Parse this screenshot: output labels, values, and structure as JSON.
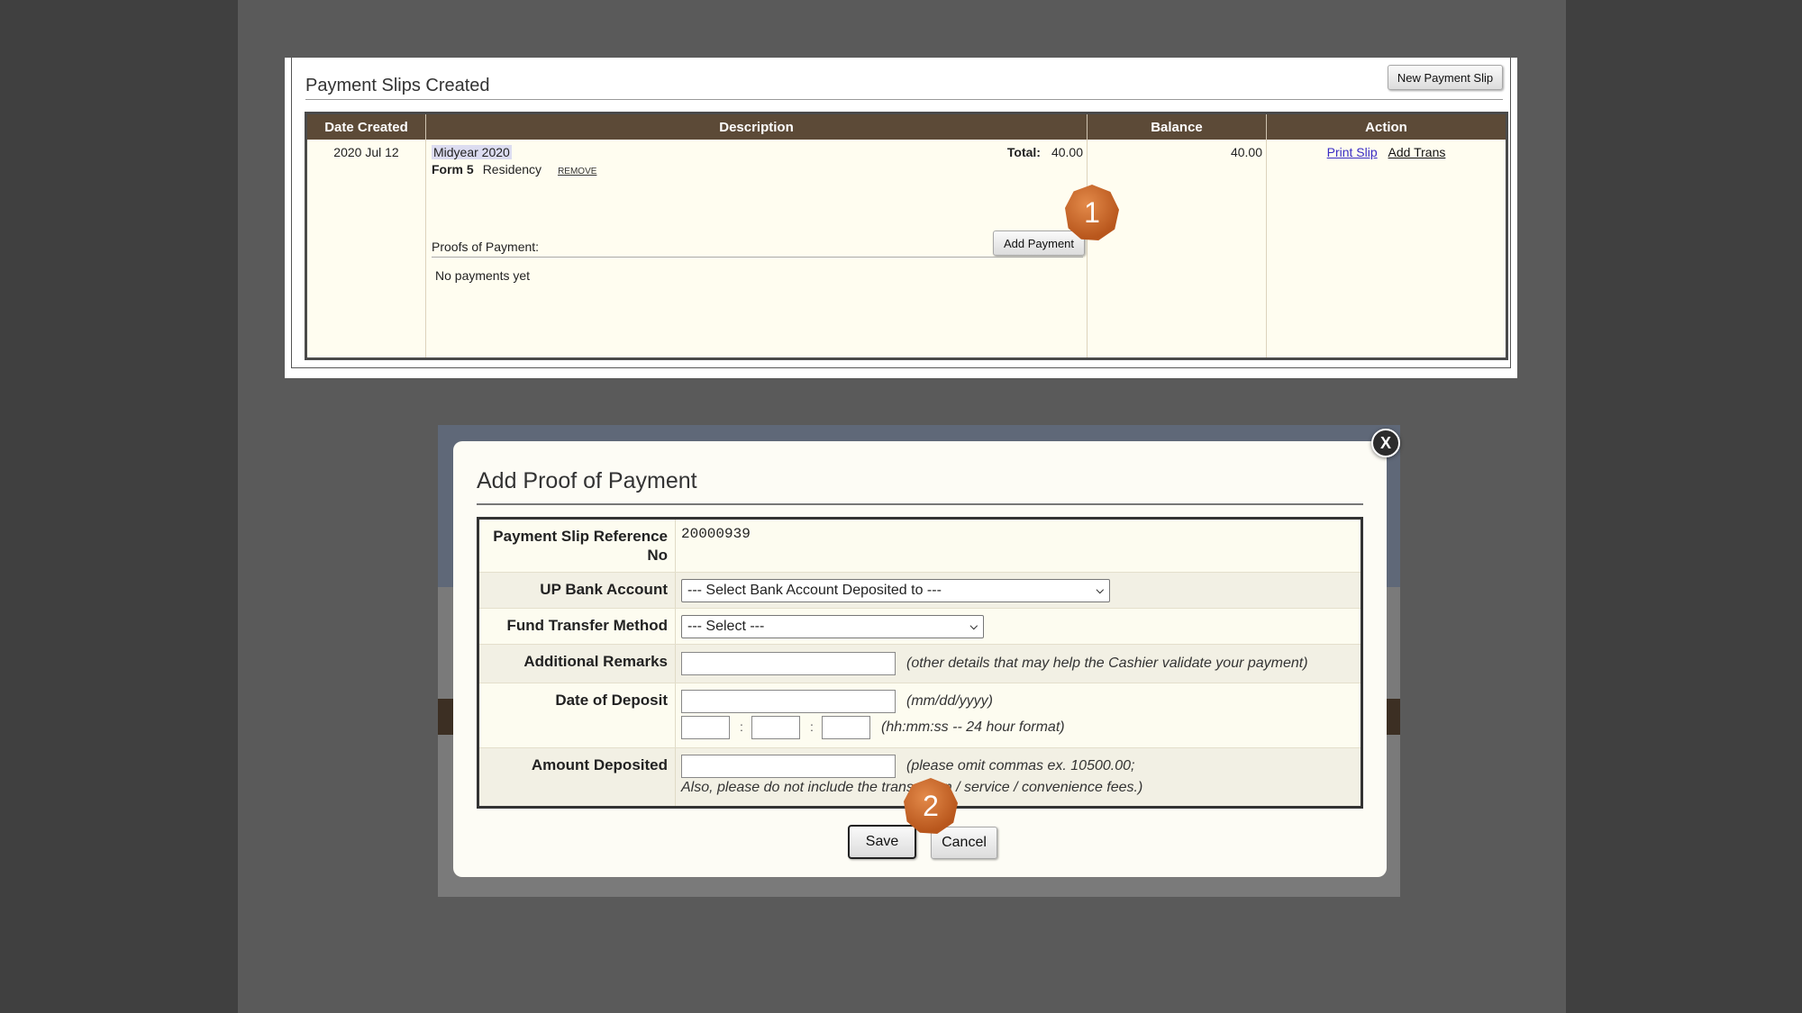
{
  "payment_slips": {
    "section_title": "Payment Slips Created",
    "new_slip_label": "New Payment Slip",
    "columns": [
      "Date Created",
      "Description",
      "Balance",
      "Action"
    ],
    "row": {
      "date": "2020 Jul 12",
      "semester": "Midyear 2020",
      "form": "Form 5",
      "type": "Residency",
      "remove_label": "REMOVE",
      "total_label": "Total:",
      "total_value": "40.00",
      "proofs_label": "Proofs of Payment:",
      "add_payment_label": "Add Payment",
      "no_payments": "No payments yet",
      "balance": "40.00",
      "print_slip_label": "Print Slip",
      "add_trans_label": "Add Trans"
    }
  },
  "modal": {
    "title": "Add Proof of Payment",
    "close_label": "X",
    "fields": {
      "ref_label": "Payment Slip Reference No",
      "ref_value": "20000939",
      "bank_label": "UP Bank Account",
      "bank_select": "--- Select Bank Account Deposited to ---",
      "method_label": "Fund Transfer Method",
      "method_select": "--- Select ---",
      "remarks_label": "Additional Remarks",
      "remarks_hint": "(other details that may help the Cashier validate your payment)",
      "date_label": "Date of Deposit",
      "date_hint": "(mm/dd/yyyy)",
      "time_hint": "(hh:mm:ss -- 24 hour format)",
      "time_sep": ":",
      "amount_label": "Amount Deposited",
      "amount_hint_1": "(please omit commas ex. 10500.00;",
      "amount_hint_2": "Also, please do not include the transaction / service / convenience fees.)"
    },
    "save_label": "Save",
    "cancel_label": "Cancel"
  },
  "markers": {
    "one": "1",
    "two": "2"
  },
  "colors": {
    "table_header": "#5c4a37",
    "marker": "#c0642a",
    "link": "#3a2cc4"
  }
}
